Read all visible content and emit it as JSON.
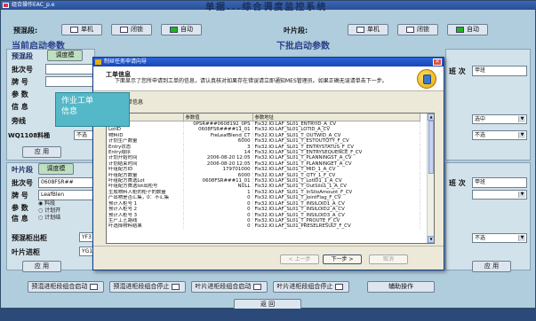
{
  "window": {
    "title": "组合操作EAC_p.e",
    "caption": "单据...综合调度监控系统"
  },
  "top_status": {
    "left_label": "预混段:",
    "left_buttons": [
      "单机",
      "闭锁",
      "自动"
    ],
    "right_label": "叶片段:",
    "right_buttons": [
      "单机",
      "闭锁",
      "自动"
    ]
  },
  "left": {
    "current_params_title": "当前启动参数",
    "next_params_title": "下批启动参数",
    "premix": {
      "section": "预混段",
      "buttons": [
        "调度模",
        "暂停"
      ],
      "fields": [
        "批次号",
        "牌 号",
        "参 数",
        "信 息"
      ],
      "extra_label": "旁线",
      "wq_label": "WQ1108料桶",
      "wq_value": "不选",
      "apply": "应 用"
    },
    "leaf": {
      "section": "叶片段",
      "buttons": [
        "调度模"
      ],
      "batch_label": "批次号",
      "batch_value": "0608FSR##",
      "brand_label": "牌 号",
      "brand_value": "LeafBlen",
      "param_label": "参 数",
      "info_label": "信 息",
      "radios": [
        "料段",
        "计划开",
        "计划结"
      ],
      "mix_label": "预混柜出柜",
      "mix_value": "YF3",
      "leaf_label": "叶片进柜",
      "leaf_value": "YG1",
      "apply": "应 用"
    }
  },
  "right": {
    "shift_label": "班 次",
    "shift_value": "甲班",
    "premix_select": "选中",
    "premix_select2": "不选",
    "leaf_shift_label": "班 次",
    "leaf_shift_value": "甲班",
    "leaf_select": "不选",
    "apply": "应 用"
  },
  "bottom_buttons": [
    "预混进柜段组合启动",
    "预混进柜段组合停止",
    "叶片进柜段组合启动",
    "叶片进柜段组合停止",
    "辅助操作"
  ],
  "back_button": "返 回",
  "dialog": {
    "title": "制丝任务申请向导",
    "header": "工单信息",
    "desc": "下面显示了您所申请到工单的信息，请认真核对如果存在错误请立即通知MES管理员。如果正确无误请单击下一步。",
    "subheader": "该次的工单信息",
    "columns": [
      "",
      "参数值",
      "参数地址"
    ],
    "rows": [
      [
        "批次号",
        "0PSR###0608192_0PS",
        "Fix32.IO.LAF_SL01_ENTRYID_A_CV"
      ],
      [
        "LotID",
        "0608FSR####11_01",
        "Fix32.IO.LAF_SL01_LOTID_A_CV"
      ],
      [
        "物料ID",
        "FreLeafBlend_CT",
        "Fix32.IO.LAF_SL01_T_OUTWID_A_CV"
      ],
      [
        "计划生产数量",
        "6000",
        "Fix32.IO.LAF_SL01_T_ESTOUTQTY_F_CV"
      ],
      [
        "Entry状态",
        "3",
        "Fix32.IO.LAF_SL01_T_ENTRYSTATUS_F_CV"
      ],
      [
        "Entry顺序",
        "14",
        "Fix32.IO.LAF_SL01_T_ENTRYSEQUENCE_F_CV"
      ],
      [
        "计划开始时间",
        "2006-08-20 12:05",
        "Fix32.IO.LAF_SL01_T_PLANNINGST_A_CV"
      ],
      [
        "计划结束时间",
        "2006-08-20 12:05",
        "Fix32.IO.LAF_SL01_T_PLANNINGET_A_CV"
      ],
      [
        "叶组配方ID",
        "179701000",
        "Fix32.IO.LAF_SL01_T_MID_1_A_CV"
      ],
      [
        "叶组配方数量",
        "6000",
        "Fix32.IO.LAF_SL01_T_QTY_1_F_CV"
      ],
      [
        "叶组配方首选Lot",
        "0608FSR###11_01",
        "Fix32.IO.LAF_SL01_T_LotID1_1_A_CV"
      ],
      [
        "叶组配方首选lot出柜号",
        "NULL",
        "Fix32.IO.LAF_SL01_T_OutSilo1_1_A_CV"
      ],
      [
        "生成物料入柜的柜子的数量",
        "1",
        "Fix32.IO.LAF_SL01_T_InSiloAmount_F_CV"
      ],
      [
        "产出物是否汇集，0：不汇集",
        "0",
        "Fix32.IO.LAF_SL01_T_JointFlag_F_CV"
      ],
      [
        "预计入柜号 1",
        "0",
        "Fix32.IO.LAF_SL01_T_INSILOID1_A_CV"
      ],
      [
        "预计入柜号 2",
        "0",
        "Fix32.IO.LAF_SL01_T_INSILOID2_A_CV"
      ],
      [
        "预计入柜号 3",
        "0",
        "Fix32.IO.LAF_SL01_T_INSILOID3_A_CV"
      ],
      [
        "生产工艺路线",
        "0",
        "Fix32.IO.LAF_SL01_T_PROUTE_F_CV"
      ],
      [
        "叶选择物料结果",
        "0",
        "Fix32.IO.LAF_SL01_PRESELRESULT_F_CV"
      ]
    ],
    "buttons": {
      "prev": "< 上一步",
      "next": "下一步 >",
      "cancel": "取消"
    }
  },
  "callout": {
    "line1": "作业工单",
    "line2": "信息"
  }
}
